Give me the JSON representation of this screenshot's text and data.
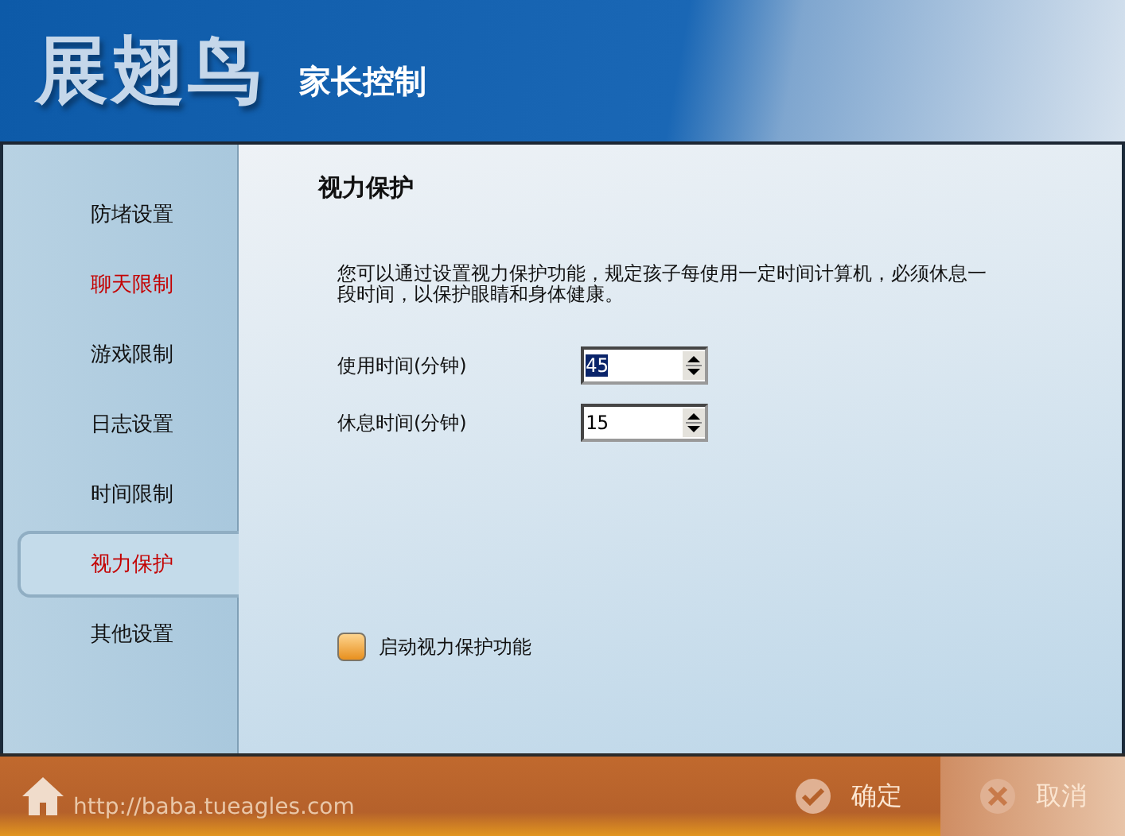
{
  "header": {
    "logo": "展翅鸟",
    "subtitle": "家长控制"
  },
  "sidebar": {
    "items": [
      {
        "label": "防堵设置",
        "selected": false,
        "highlighted": false
      },
      {
        "label": "聊天限制",
        "selected": false,
        "highlighted": true
      },
      {
        "label": "游戏限制",
        "selected": false,
        "highlighted": false
      },
      {
        "label": "日志设置",
        "selected": false,
        "highlighted": false
      },
      {
        "label": "时间限制",
        "selected": false,
        "highlighted": false
      },
      {
        "label": "视力保护",
        "selected": true,
        "highlighted": true
      },
      {
        "label": "其他设置",
        "selected": false,
        "highlighted": false
      }
    ]
  },
  "content": {
    "title": "视力保护",
    "description": "您可以通过设置视力保护功能，规定孩子每使用一定时间计算机，必须休息一段时间，以保护眼睛和身体健康。",
    "fields": [
      {
        "label": "使用时间(分钟)",
        "value": "45",
        "selected": true
      },
      {
        "label": "休息时间(分钟)",
        "value": "15",
        "selected": false
      }
    ],
    "enable": {
      "label": "启动视力保护功能",
      "checked": false
    }
  },
  "footer": {
    "url": "http://baba.tueagles.com",
    "buttons": [
      {
        "kind": "ok",
        "label": "确定"
      },
      {
        "kind": "cancel",
        "label": "取消"
      }
    ]
  }
}
